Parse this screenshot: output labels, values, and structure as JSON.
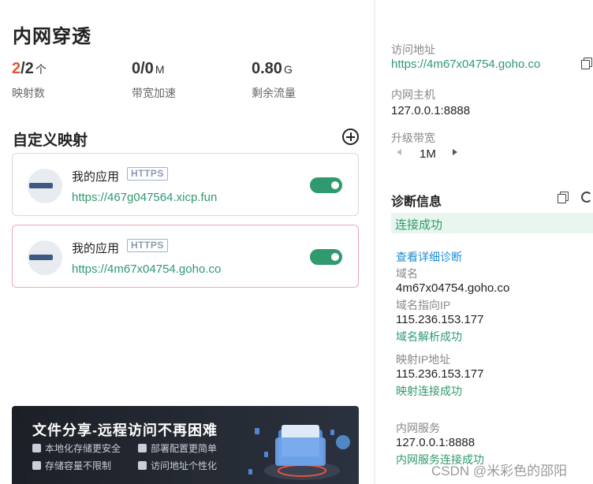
{
  "left": {
    "title": "内网穿透",
    "stats": [
      {
        "highlight": "2",
        "rest": "/2",
        "unit": "个",
        "label": "映射数"
      },
      {
        "highlight": "",
        "rest": "0/0",
        "unit": "M",
        "label": "带宽加速"
      },
      {
        "highlight": "",
        "rest": "0.80",
        "unit": "G",
        "label": "剩余流量"
      }
    ],
    "section_title": "自定义映射",
    "mappings": [
      {
        "name": "我的应用",
        "protocol": "HTTPS",
        "url": "https://467g047564.xicp.fun",
        "enabled": true
      },
      {
        "name": "我的应用",
        "protocol": "HTTPS",
        "url": "https://4m67x04754.goho.co",
        "enabled": true
      }
    ],
    "banner": {
      "title": "文件分享-远程访问不再困难",
      "features": [
        "本地化存储更安全",
        "部署配置更简单",
        "存储容量不限制",
        "访问地址个性化"
      ]
    }
  },
  "right": {
    "access_label": "访问地址",
    "access_url": "https://4m67x04754.goho.co",
    "host_label": "内网主机",
    "host_value": "127.0.0.1:8888",
    "bandwidth_label": "升级带宽",
    "bandwidth_value": "1M",
    "diag_title": "诊断信息",
    "diag_status": "连接成功",
    "diag_detail_link": "查看详细诊断",
    "domain_label": "域名",
    "domain_value": "4m67x04754.goho.co",
    "domain_ip_label": "域名指向IP",
    "domain_ip_value": "115.236.153.177",
    "domain_ok": "域名解析成功",
    "map_ip_label": "映射IP地址",
    "map_ip_value": "115.236.153.177",
    "map_ok": "映射连接成功",
    "lan_label": "内网服务",
    "lan_value": "127.0.0.1:8888",
    "lan_ok": "内网服务连接成功"
  },
  "watermark": "CSDN @米彩色的邵阳",
  "colors": {
    "accent_green": "#2e9a6e",
    "highlight_red": "#e5533c",
    "link_blue": "#1a8cd8",
    "card_active_border": "#f0a7b8"
  }
}
